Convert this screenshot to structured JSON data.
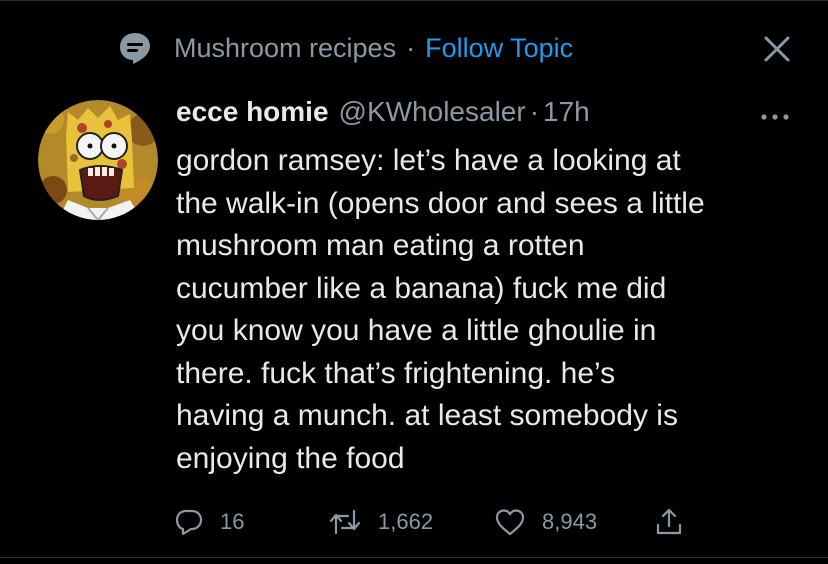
{
  "topic": {
    "name": "Mushroom recipes",
    "separator": "·",
    "follow_label": "Follow Topic",
    "icon": "topic-icon",
    "close_icon": "close-icon"
  },
  "tweet": {
    "display_name": "ecce homie",
    "handle": "@KWholesaler",
    "separator": "·",
    "time": "17h",
    "avatar": "avatar",
    "more_icon": "more-icon",
    "body_lines": [
      "gordon ramsey: let’s have a looking at",
      "the walk-in (opens door and sees a little",
      "mushroom man eating a rotten",
      "cucumber like a banana) fuck me did",
      "you know you have a little ghoulie in",
      "there. fuck that’s frightening. he’s",
      "having a munch. at least somebody is",
      "enjoying the food"
    ],
    "actions": {
      "reply_count": "16",
      "retweet_count": "1,662",
      "like_count": "8,943",
      "reply_icon": "reply-icon",
      "retweet_icon": "retweet-icon",
      "like_icon": "like-icon",
      "share_icon": "share-icon"
    }
  },
  "colors": {
    "background": "#000000",
    "text_primary": "#e7e9ea",
    "text_secondary": "#8b98a5",
    "accent": "#1d9bf0",
    "divider": "#2f3336"
  }
}
